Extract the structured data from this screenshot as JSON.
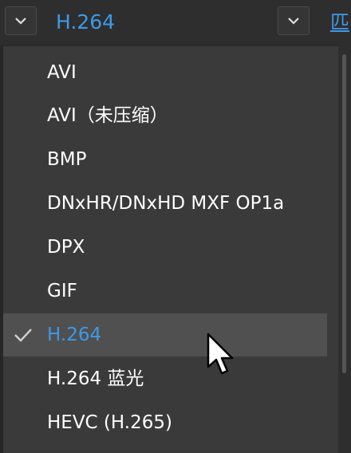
{
  "topbar": {
    "selected_format": "H.264",
    "right_link": "匹",
    "left_dropdown_icon": "chevron-down-icon",
    "mid_dropdown_icon": "chevron-down-icon"
  },
  "menu": {
    "items": [
      {
        "label": "AVI"
      },
      {
        "label": "AVI（未压缩）"
      },
      {
        "label": "BMP"
      },
      {
        "label": "DNxHR/DNxHD MXF OP1a"
      },
      {
        "label": "DPX"
      },
      {
        "label": "GIF"
      },
      {
        "label": "H.264",
        "selected": true
      },
      {
        "label": "H.264 蓝光"
      },
      {
        "label": "HEVC (H.265)"
      }
    ],
    "check_icon": "checkmark-icon"
  },
  "colors": {
    "accent": "#3d9ae8",
    "menu_bg": "#3a3a3a",
    "selected_bg": "#505050",
    "text": "#ffffff"
  },
  "cursor_icon": "mouse-pointer-icon"
}
